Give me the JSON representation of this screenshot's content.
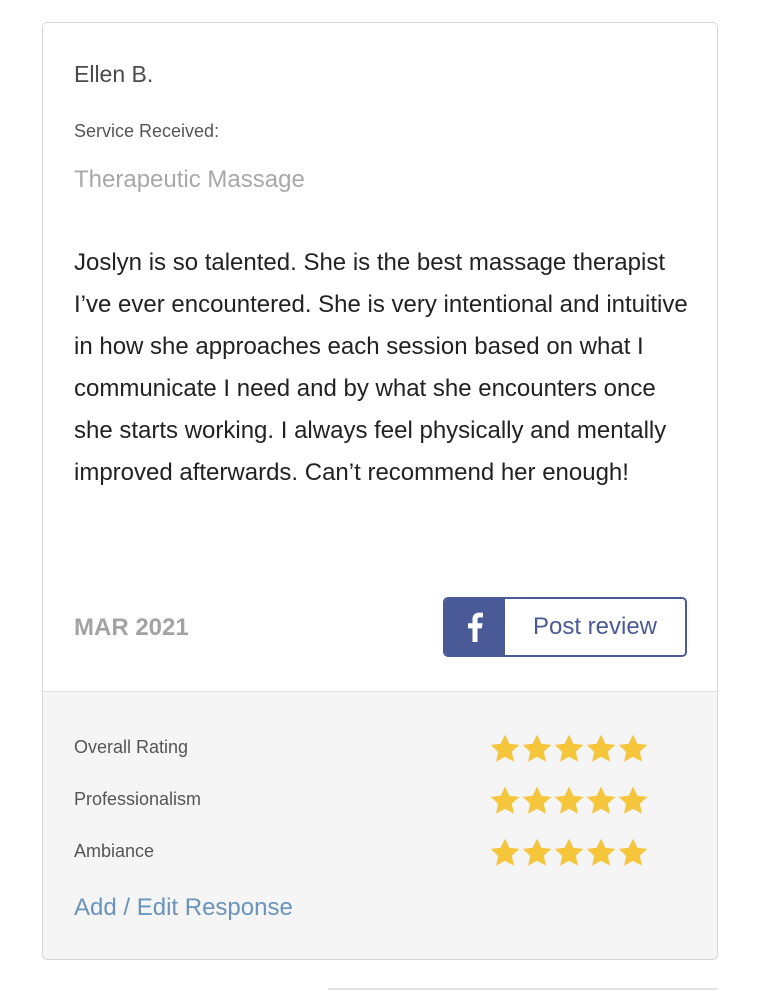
{
  "review": {
    "reviewer_name": "Ellen B.",
    "service_label": "Service Received:",
    "service_value": "Therapeutic Massage",
    "text": "Joslyn is so talented. She is the best massage therapist I’ve ever encountered. She is very intentional and intuitive in how she approaches each session based on what I communicate I need and by what she encounters once she starts working. I always feel physically and mentally improved afterwards. Can’t recommend her enough!",
    "date": "MAR 2021"
  },
  "share": {
    "icon": "facebook-icon",
    "label": "Post review",
    "color": "#4a5a96"
  },
  "ratings": [
    {
      "label": "Overall Rating",
      "stars": 5,
      "max": 5
    },
    {
      "label": "Professionalism",
      "stars": 5,
      "max": 5
    },
    {
      "label": "Ambiance",
      "stars": 5,
      "max": 5
    }
  ],
  "star_color": "#f5c53c",
  "response_link": "Add / Edit Response"
}
